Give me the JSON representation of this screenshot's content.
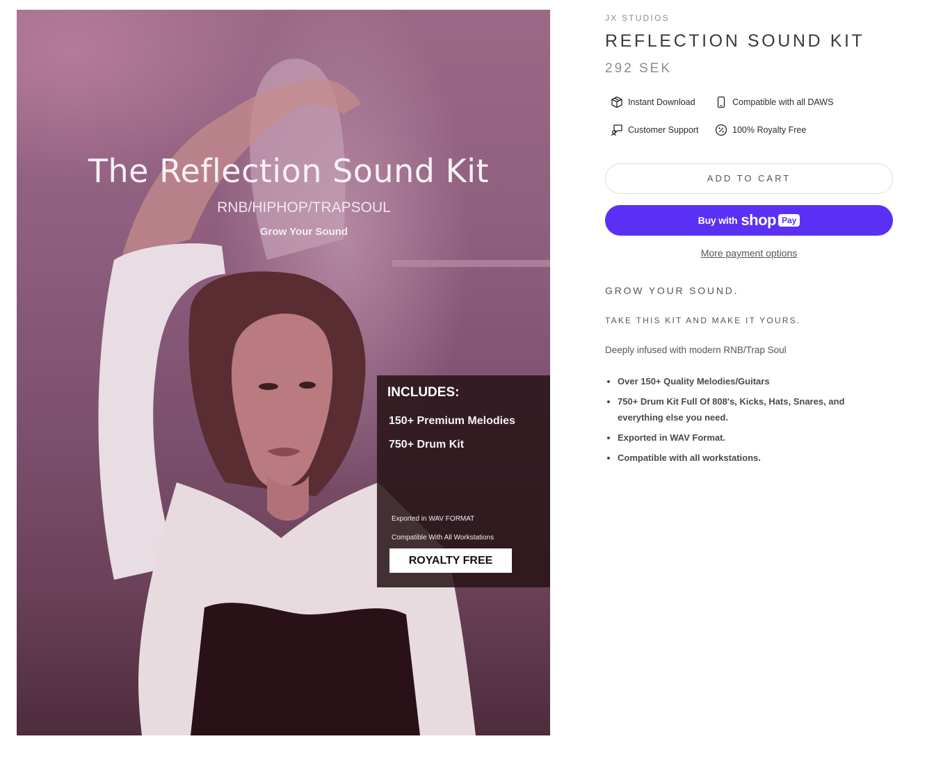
{
  "product_image": {
    "title": "The Reflection Sound Kit",
    "subtitle": "RNB/HIPHOP/TRAPSOUL",
    "tagline": "Grow Your Sound",
    "includes_heading": "INCLUDES:",
    "includes_items": [
      "150+ Premium Melodies",
      "750+ Drum Kit"
    ],
    "format_note": "Exported in WAV FORMAT",
    "compat_note": "Compatible With All Workstations",
    "royalty_label": "ROYALTY FREE"
  },
  "product": {
    "vendor": "JX STUDIOS",
    "title": "REFLECTION SOUND KIT",
    "price": "292 SEK"
  },
  "features": [
    {
      "label": "Instant Download",
      "icon": "box-icon"
    },
    {
      "label": "Compatible with all DAWS",
      "icon": "phone-icon"
    },
    {
      "label": "Customer Support",
      "icon": "chat-support-icon"
    },
    {
      "label": "100% Royalty Free",
      "icon": "percent-badge-icon"
    }
  ],
  "actions": {
    "add_to_cart": "ADD TO CART",
    "buy_with": "Buy with",
    "shop": "shop",
    "pay": "Pay",
    "more_payment": "More payment options"
  },
  "description": {
    "heading": "GROW YOUR SOUND.",
    "subheading": "TAKE THIS KIT AND MAKE IT YOURS.",
    "text": "Deeply infused with modern RNB/Trap Soul",
    "bullets": [
      "Over 150+ Quality Melodies/Guitars",
      "750+ Drum Kit Full Of 808's, Kicks, Hats, Snares, and everything else you need.",
      "Exported in WAV Format.",
      "Compatible with all workstations."
    ]
  },
  "colors": {
    "shop_pay": "#5a31f4",
    "image_tint": "#8f5f7f",
    "includes_panel": "#261416"
  }
}
